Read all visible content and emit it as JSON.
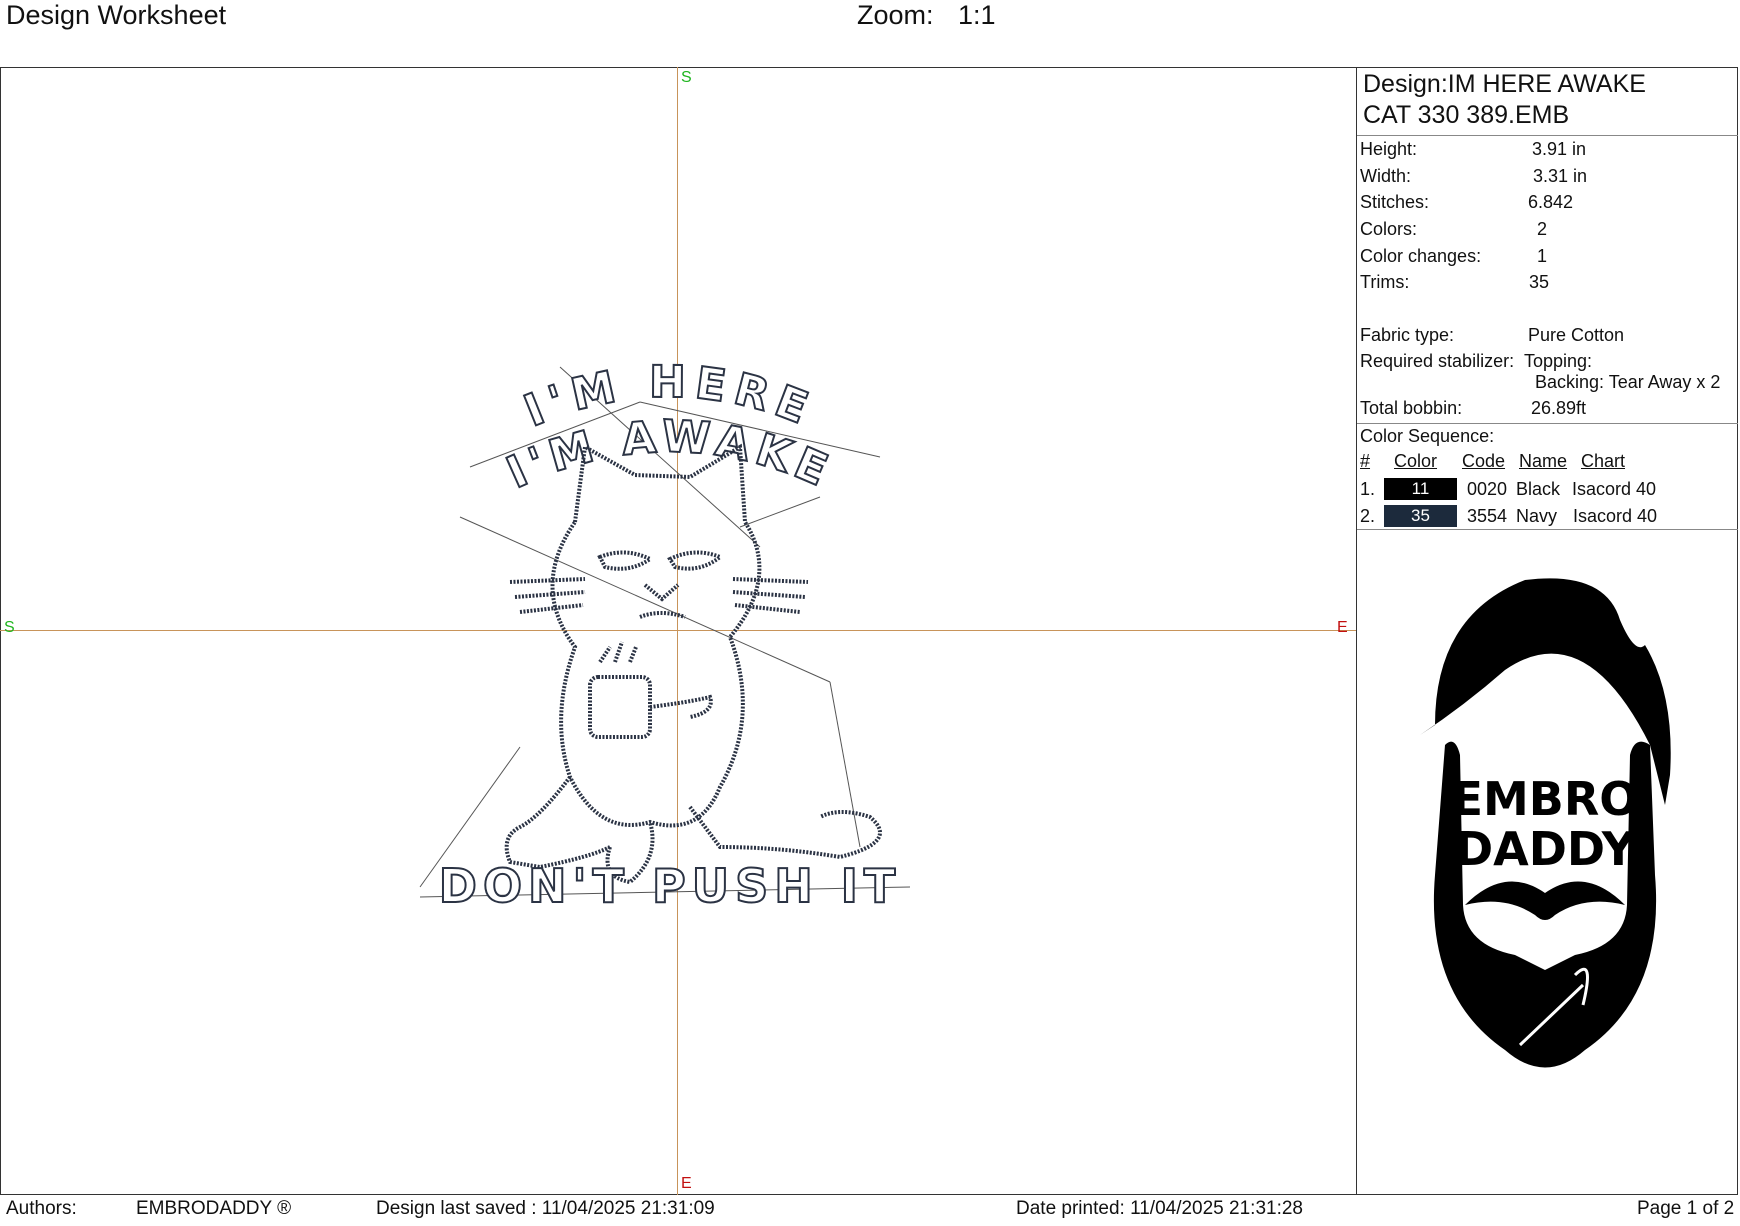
{
  "header": {
    "title": "Design Worksheet",
    "zoom_label": "Zoom:",
    "zoom_value": "1:1"
  },
  "canvas": {
    "marks": {
      "top": "S",
      "left": "S",
      "right": "E",
      "bottom": "E"
    },
    "design_text": {
      "line1": "I'M HERE",
      "line2": "I'M AWAKE",
      "line3": "DON'T PUSH IT"
    },
    "colors": {
      "stitch": "#2b3344",
      "axis": "#c8945a",
      "start": "#1fb51f",
      "end": "#c21010"
    }
  },
  "info": {
    "design_line1": "Design:IM HERE AWAKE",
    "design_line2": "CAT 330 389.EMB",
    "height_label": "Height:",
    "height_value": "3.91 in",
    "width_label": "Width:",
    "width_value": "3.31 in",
    "stitches_label": "Stitches:",
    "stitches_value": "6.842",
    "colors_label": "Colors:",
    "colors_value": "2",
    "changes_label": "Color changes:",
    "changes_value": "1",
    "trims_label": "Trims:",
    "trims_value": "35",
    "fabric_label": "Fabric type:",
    "fabric_value": "Pure Cotton",
    "stabilizer_label": "Required stabilizer:",
    "topping": "Topping:",
    "backing": "Backing: Tear Away x 2",
    "bobbin_label": "Total bobbin:",
    "bobbin_value": "26.89ft"
  },
  "color_sequence": {
    "title": "Color Sequence:",
    "headers": {
      "num": "#",
      "color": "Color",
      "code": "Code",
      "name": "Name",
      "chart": "Chart"
    },
    "rows": [
      {
        "num": "1.",
        "swatch_label": "11",
        "swatch_color": "#000000",
        "code": "0020",
        "name": "Black",
        "chart": "Isacord 40"
      },
      {
        "num": "2.",
        "swatch_label": "35",
        "swatch_color": "#1c2a3c",
        "code": "3554",
        "name": "Navy",
        "chart": "Isacord 40"
      }
    ]
  },
  "logo": {
    "line1": "EMBRO",
    "line2": "DADDY"
  },
  "footer": {
    "authors_label": "Authors:",
    "authors_value": "EMBRODADDY ®",
    "saved": "Design last saved : 11/04/2025 21:31:09",
    "printed": "Date printed: 11/04/2025 21:31:28",
    "page": "Page 1 of 2"
  }
}
